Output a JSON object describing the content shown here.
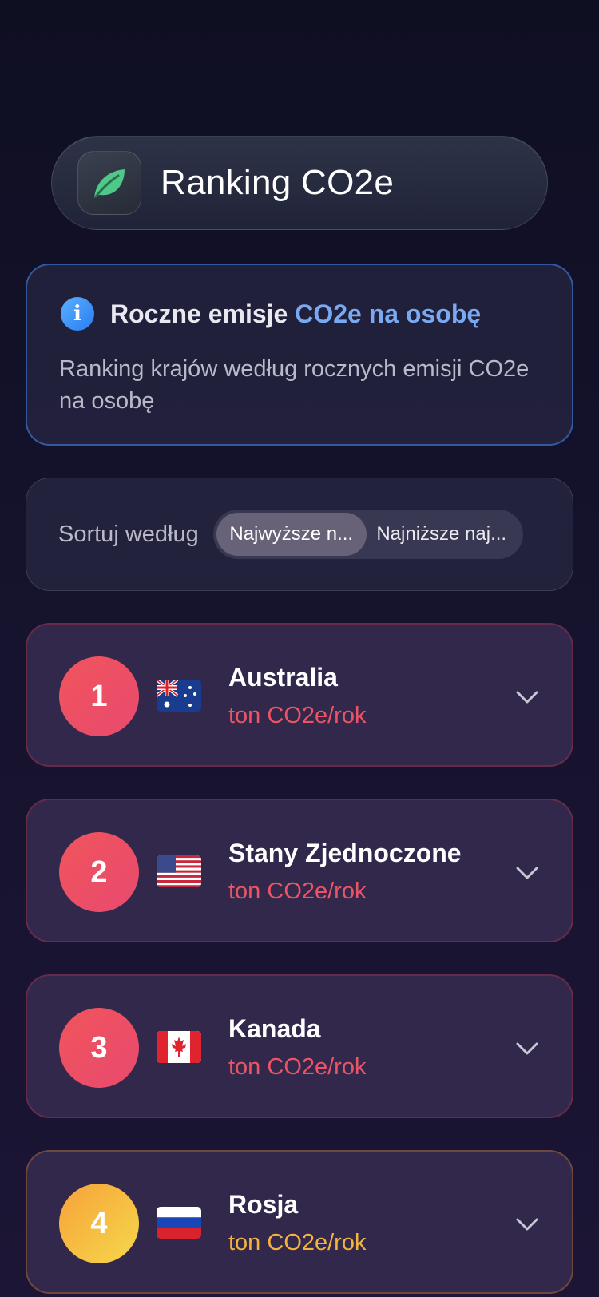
{
  "header": {
    "title": "Ranking CO2e",
    "icon": "leaf-icon"
  },
  "info": {
    "title_prefix": "Roczne emisje ",
    "title_accent": "CO2e na osobę",
    "description": "Ranking krajów według rocznych emisji CO2e na osobę"
  },
  "sort": {
    "label": "Sortuj według",
    "options": [
      "Najwyższe n...",
      "Najniższe naj..."
    ],
    "selected": "Najwyższe n..."
  },
  "countries": [
    {
      "rank": "1",
      "name": "Australia",
      "unit": "ton CO2e/rok",
      "flag": "australia-flag",
      "color": "#ec5466"
    },
    {
      "rank": "2",
      "name": "Stany Zjednoczone",
      "unit": "ton CO2e/rok",
      "flag": "usa-flag",
      "color": "#ec5466"
    },
    {
      "rank": "3",
      "name": "Kanada",
      "unit": "ton CO2e/rok",
      "flag": "canada-flag",
      "color": "#ec5466"
    },
    {
      "rank": "4",
      "name": "Rosja",
      "unit": "ton CO2e/rok",
      "flag": "russia-flag",
      "color": "#f2b23c"
    }
  ]
}
